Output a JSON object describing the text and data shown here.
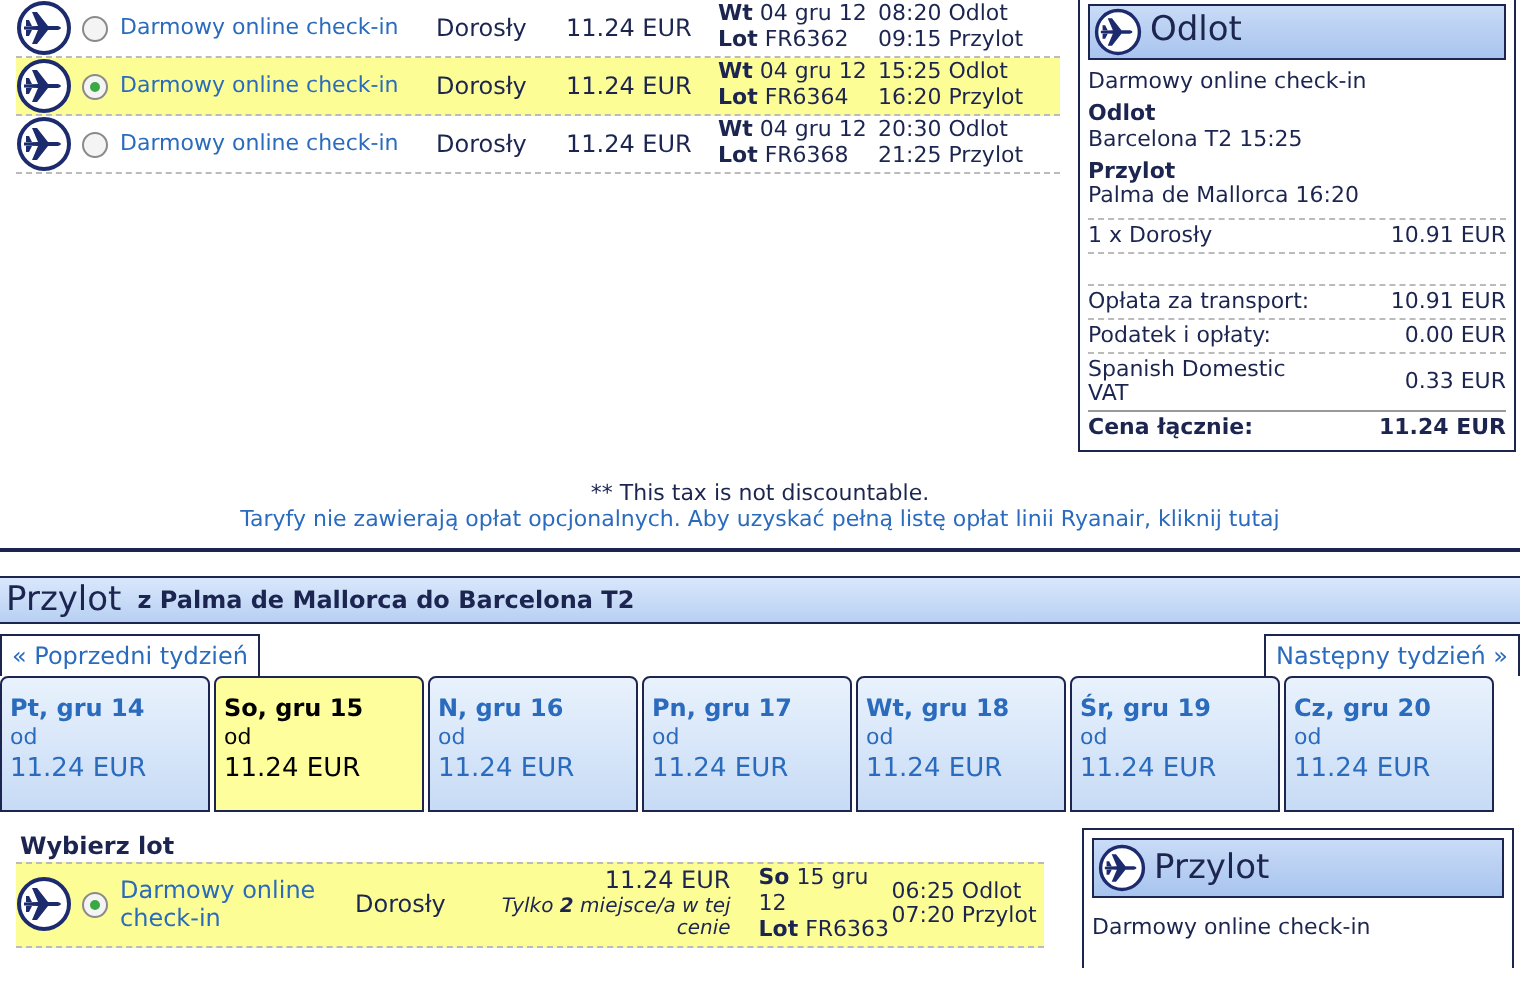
{
  "outbound": {
    "flights": [
      {
        "fare": "Darmowy online check-in",
        "passenger": "Dorosły",
        "price": "11.24 EUR",
        "day": "Wt",
        "date": "04 gru 12",
        "flight_label": "Lot",
        "flight_no": "FR6362",
        "dep_time": "08:20",
        "dep_label": "Odlot",
        "arr_time": "09:15",
        "arr_label": "Przylot",
        "selected": false
      },
      {
        "fare": "Darmowy online check-in",
        "passenger": "Dorosły",
        "price": "11.24 EUR",
        "day": "Wt",
        "date": "04 gru 12",
        "flight_label": "Lot",
        "flight_no": "FR6364",
        "dep_time": "15:25",
        "dep_label": "Odlot",
        "arr_time": "16:20",
        "arr_label": "Przylot",
        "selected": true
      },
      {
        "fare": "Darmowy online check-in",
        "passenger": "Dorosły",
        "price": "11.24 EUR",
        "day": "Wt",
        "date": "04 gru 12",
        "flight_label": "Lot",
        "flight_no": "FR6368",
        "dep_time": "20:30",
        "dep_label": "Odlot",
        "arr_time": "21:25",
        "arr_label": "Przylot",
        "selected": false
      }
    ]
  },
  "summary": {
    "title": "Odlot",
    "fare": "Darmowy online check-in",
    "dep_heading": "Odlot",
    "dep_detail": "Barcelona T2 15:25",
    "arr_heading": "Przylot",
    "arr_detail": "Palma de Mallorca 16:20",
    "passengers": [
      {
        "label": "1 x Dorosły",
        "amount": "10.91 EUR"
      }
    ],
    "fees": [
      {
        "label": "Opłata za transport:",
        "amount": "10.91 EUR"
      },
      {
        "label": "Podatek i opłaty:",
        "amount": "0.00 EUR"
      },
      {
        "label": "Spanish Domestic VAT",
        "amount": "0.33 EUR"
      }
    ],
    "total_label": "Cena łącznie:",
    "total": "11.24 EUR"
  },
  "notes": {
    "tax_note": "** This tax is not discountable.",
    "fees_link": "Taryfy nie zawierają opłat opcjonalnych. Aby uzyskać pełną listę opłat linii Ryanair, kliknij tutaj"
  },
  "return": {
    "title": "Przylot",
    "route": "z Palma de Mallorca do Barcelona T2",
    "prev_week": "« Poprzedni tydzień",
    "next_week": "Następny tydzień »",
    "days": [
      {
        "label": "Pt, gru 14",
        "from": "od",
        "price": "11.24 EUR",
        "selected": false
      },
      {
        "label": "So, gru 15",
        "from": "od",
        "price": "11.24 EUR",
        "selected": true
      },
      {
        "label": "N, gru 16",
        "from": "od",
        "price": "11.24 EUR",
        "selected": false
      },
      {
        "label": "Pn, gru 17",
        "from": "od",
        "price": "11.24 EUR",
        "selected": false
      },
      {
        "label": "Wt, gru 18",
        "from": "od",
        "price": "11.24 EUR",
        "selected": false
      },
      {
        "label": "Śr, gru 19",
        "from": "od",
        "price": "11.24 EUR",
        "selected": false
      },
      {
        "label": "Cz, gru 20",
        "from": "od",
        "price": "11.24 EUR",
        "selected": false
      }
    ],
    "choose_label": "Wybierz lot",
    "flights": [
      {
        "fare": "Darmowy online check-in",
        "passenger": "Dorosły",
        "price": "11.24 EUR",
        "availability": "Tylko **2** miejsce/a w tej cenie",
        "day": "So",
        "date": "15 gru 12",
        "flight_label": "Lot",
        "flight_no": "FR6363",
        "dep_time": "06:25",
        "dep_label": "Odlot",
        "arr_time": "07:20",
        "arr_label": "Przylot",
        "selected": true
      }
    ],
    "summary": {
      "title": "Przylot",
      "fare": "Darmowy online check-in"
    }
  }
}
